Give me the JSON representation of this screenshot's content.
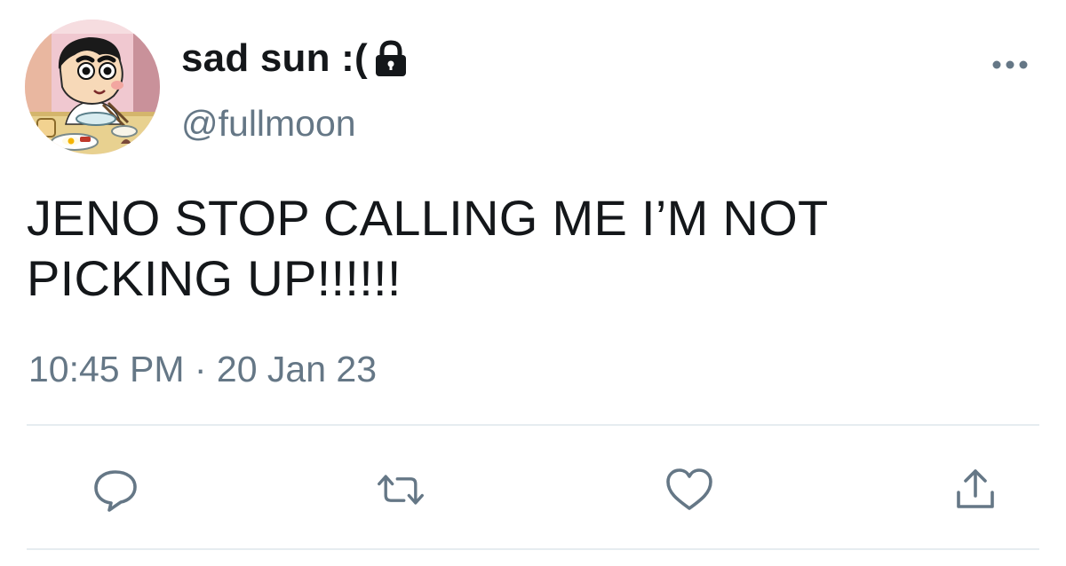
{
  "user": {
    "display_name": "sad sun :(",
    "handle": "@fullmoon",
    "avatar_icon": "cartoon-boy-avatar",
    "protected_icon": "lock-icon"
  },
  "tweet": {
    "text": "JENO STOP CALLING ME I’M NOT\nPICKING UP!!!!!!",
    "timestamp": "10:45 PM · 20 Jan 23"
  },
  "actions": [
    {
      "name": "reply",
      "icon": "reply-icon"
    },
    {
      "name": "retweet",
      "icon": "retweet-icon"
    },
    {
      "name": "like",
      "icon": "heart-icon"
    },
    {
      "name": "share",
      "icon": "share-icon"
    }
  ],
  "menu": {
    "icon": "more-icon"
  },
  "colors": {
    "text": "#14171a",
    "secondary": "#657786",
    "divider": "#e6ecf0",
    "background": "#ffffff"
  }
}
